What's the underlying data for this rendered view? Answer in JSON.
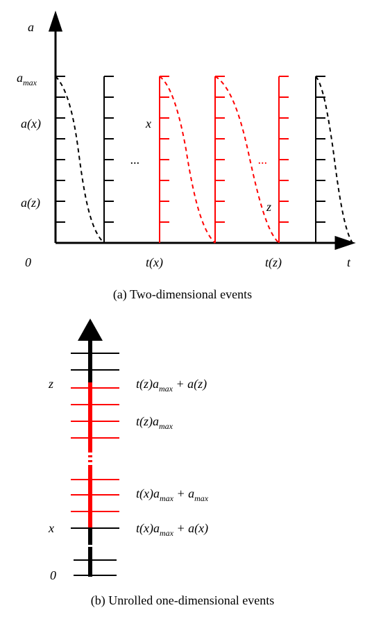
{
  "top": {
    "yAxisLabel": "a",
    "xAxisLabel": "t",
    "originLabel": "0",
    "xTick1": "t(x)",
    "xTick2": "t(z)",
    "yTickTop": "a",
    "yTickTopSub": "max",
    "yTickMid": "a(x)",
    "yTickLow": "a(z)",
    "labelX": "x",
    "labelZ": "z",
    "ellipsis1": "...",
    "ellipsis2": "...",
    "caption": "(a) Two-dimensional events"
  },
  "bottom": {
    "tick0": "0",
    "tickX": "x",
    "tickZ": "z",
    "expr1": "t(x)a",
    "expr1sub": "max",
    "expr1tail": " + a(x)",
    "expr2": "t(x)a",
    "expr2sub": "max",
    "expr2tail": " + a",
    "expr2tailsub": "max",
    "expr3": "t(z)a",
    "expr3sub": "max",
    "expr4": "t(z)a",
    "expr4sub": "max",
    "expr4tail": " + a(z)",
    "caption": "(b) Unrolled one-dimensional events"
  },
  "chart_data": [
    {
      "type": "line",
      "title": "(a) Two-dimensional events",
      "xlabel": "t",
      "ylabel": "a",
      "x_ticks": [
        "0",
        "t(x)",
        "t(z)"
      ],
      "y_ticks": [
        "a(z)",
        "a(x)",
        "a_max"
      ],
      "notes": "Symbolic plot: vertical rules at discrete times t=0..., repeated a-axis ticks from 0 to a_max. Dashed curves decay from a_max toward 0 between events. Red highlighted interval between t(x) and t(z). Labels x at (t(x), a(x)) and z at (t(z), a(z)).",
      "series": [
        {
          "name": "event-guides",
          "style": "vertical rules with inner ticks 0..a_max",
          "count": 6,
          "color_sequence": [
            "black",
            "black",
            "red",
            "red",
            "red",
            "black"
          ]
        },
        {
          "name": "decay-curves",
          "style": "dashed, from a_max to 0 between consecutive guides",
          "colors": [
            "black",
            "red",
            "red",
            "black"
          ]
        }
      ]
    },
    {
      "type": "axis",
      "title": "(b) Unrolled one-dimensional events",
      "orientation": "vertical",
      "label_positions_symbolic": [
        "0",
        "x = t(x)a_max + a(x)",
        "t(x)a_max + a_max",
        "t(z)a_max",
        "z = t(z)a_max + a(z)"
      ],
      "highlight_segment": "[t(x)a_max + a(x), t(z)a_max + a(z)] in red",
      "notes": "One-dimensional unrolling of (a): position of event e is t(e)*a_max + a(e)."
    }
  ]
}
